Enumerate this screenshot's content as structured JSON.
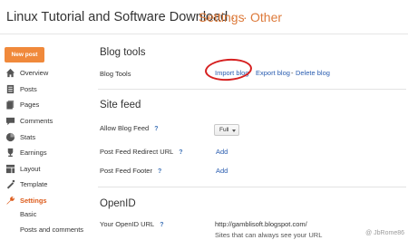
{
  "header": {
    "blog_title": "Linux Tutorial and Software Download",
    "separator": "·",
    "crumb_settings": "Settings",
    "crumb_other": "Other"
  },
  "sidebar": {
    "new_post": "New post",
    "items": [
      {
        "label": "Overview",
        "icon": "home-icon"
      },
      {
        "label": "Posts",
        "icon": "posts-icon"
      },
      {
        "label": "Pages",
        "icon": "pages-icon"
      },
      {
        "label": "Comments",
        "icon": "comment-icon"
      },
      {
        "label": "Stats",
        "icon": "stats-icon"
      },
      {
        "label": "Earnings",
        "icon": "trophy-icon"
      },
      {
        "label": "Layout",
        "icon": "layout-icon"
      },
      {
        "label": "Template",
        "icon": "template-icon"
      },
      {
        "label": "Settings",
        "icon": "wrench-icon",
        "active": true
      }
    ],
    "subitems": [
      "Basic",
      "Posts and comments"
    ]
  },
  "blog_tools": {
    "title": "Blog tools",
    "row_label": "Blog Tools",
    "import": "Import blog",
    "export": "Export blog",
    "dash": "-",
    "delete": "Delete blog"
  },
  "site_feed": {
    "title": "Site feed",
    "allow_label": "Allow Blog Feed",
    "allow_value": "Full",
    "redirect_label": "Post Feed Redirect URL",
    "redirect_action": "Add",
    "footer_label": "Post Feed Footer",
    "footer_action": "Add",
    "help": "?"
  },
  "openid": {
    "title": "OpenID",
    "url_label": "Your OpenID URL",
    "url_value": "http://gamblisoft.blogspot.com/",
    "note": "Sites that can always see your URL"
  },
  "watermark": "@ JbRome86",
  "colors": {
    "accent": "#f0893b",
    "link": "#2a5db0",
    "annotation": "#d62020",
    "breadcrumb": "#dd7a3a"
  }
}
